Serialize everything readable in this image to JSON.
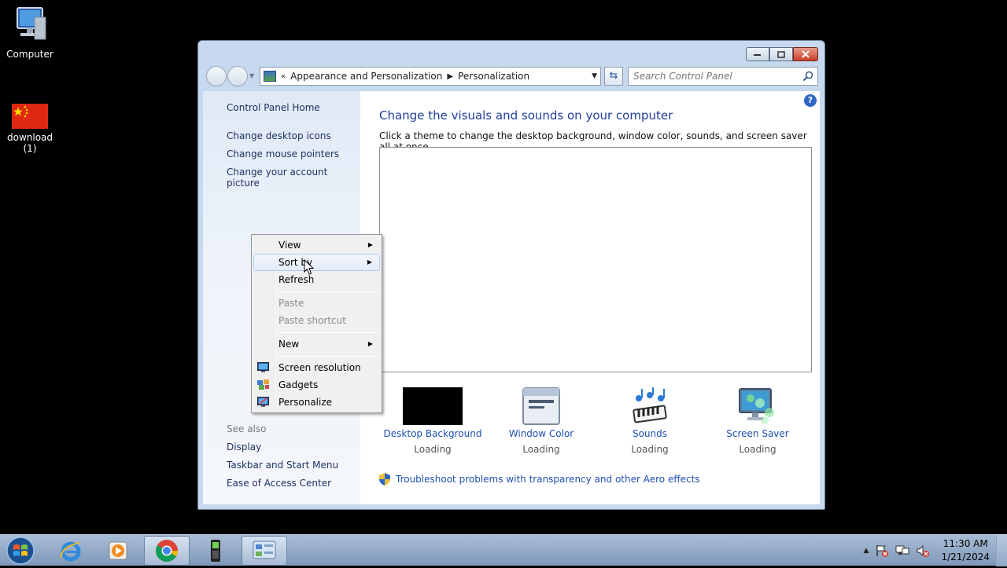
{
  "desktop": {
    "icons": [
      {
        "label": "Computer",
        "icon": "computer-icon"
      },
      {
        "label": "download (1)",
        "icon": "flag-image-icon"
      }
    ]
  },
  "window": {
    "address": {
      "prefix": "«",
      "crumbs": [
        "Appearance and Personalization",
        "Personalization"
      ]
    },
    "search_placeholder": "Search Control Panel",
    "left_pane": {
      "home": "Control Panel Home",
      "links": [
        "Change desktop icons",
        "Change mouse pointers",
        "Change your account picture"
      ],
      "see_also_heading": "See also",
      "see_also": [
        "Display",
        "Taskbar and Start Menu",
        "Ease of Access Center"
      ]
    },
    "main": {
      "title": "Change the visuals and sounds on your computer",
      "description": "Click a theme to change the desktop background, window color, sounds, and screen saver all at once.",
      "tiles": [
        {
          "label": "Desktop Background",
          "status": "Loading"
        },
        {
          "label": "Window Color",
          "status": "Loading"
        },
        {
          "label": "Sounds",
          "status": "Loading"
        },
        {
          "label": "Screen Saver",
          "status": "Loading"
        }
      ],
      "troubleshoot_link": "Troubleshoot problems with transparency and other Aero effects"
    },
    "help_glyph": "?"
  },
  "context_menu": {
    "items": [
      {
        "label": "View",
        "submenu": true
      },
      {
        "label": "Sort by",
        "submenu": true,
        "hover": true
      },
      {
        "label": "Refresh"
      },
      {
        "label": "Paste",
        "disabled": true
      },
      {
        "label": "Paste shortcut",
        "disabled": true
      },
      {
        "label": "New",
        "submenu": true
      },
      {
        "label": "Screen resolution",
        "icon": "screen-resolution-icon"
      },
      {
        "label": "Gadgets",
        "icon": "gadgets-icon"
      },
      {
        "label": "Personalize",
        "icon": "personalize-icon"
      }
    ]
  },
  "taskbar": {
    "apps": [
      "internet-explorer-icon",
      "media-player-icon",
      "chrome-icon",
      "phone-icon",
      "control-panel-icon"
    ],
    "clock": {
      "time": "11:30 AM",
      "date": "1/21/2024"
    }
  },
  "colors": {
    "link": "#1e4fb3",
    "title": "#1e3f9a",
    "taskbar": "#8fa6c4"
  }
}
